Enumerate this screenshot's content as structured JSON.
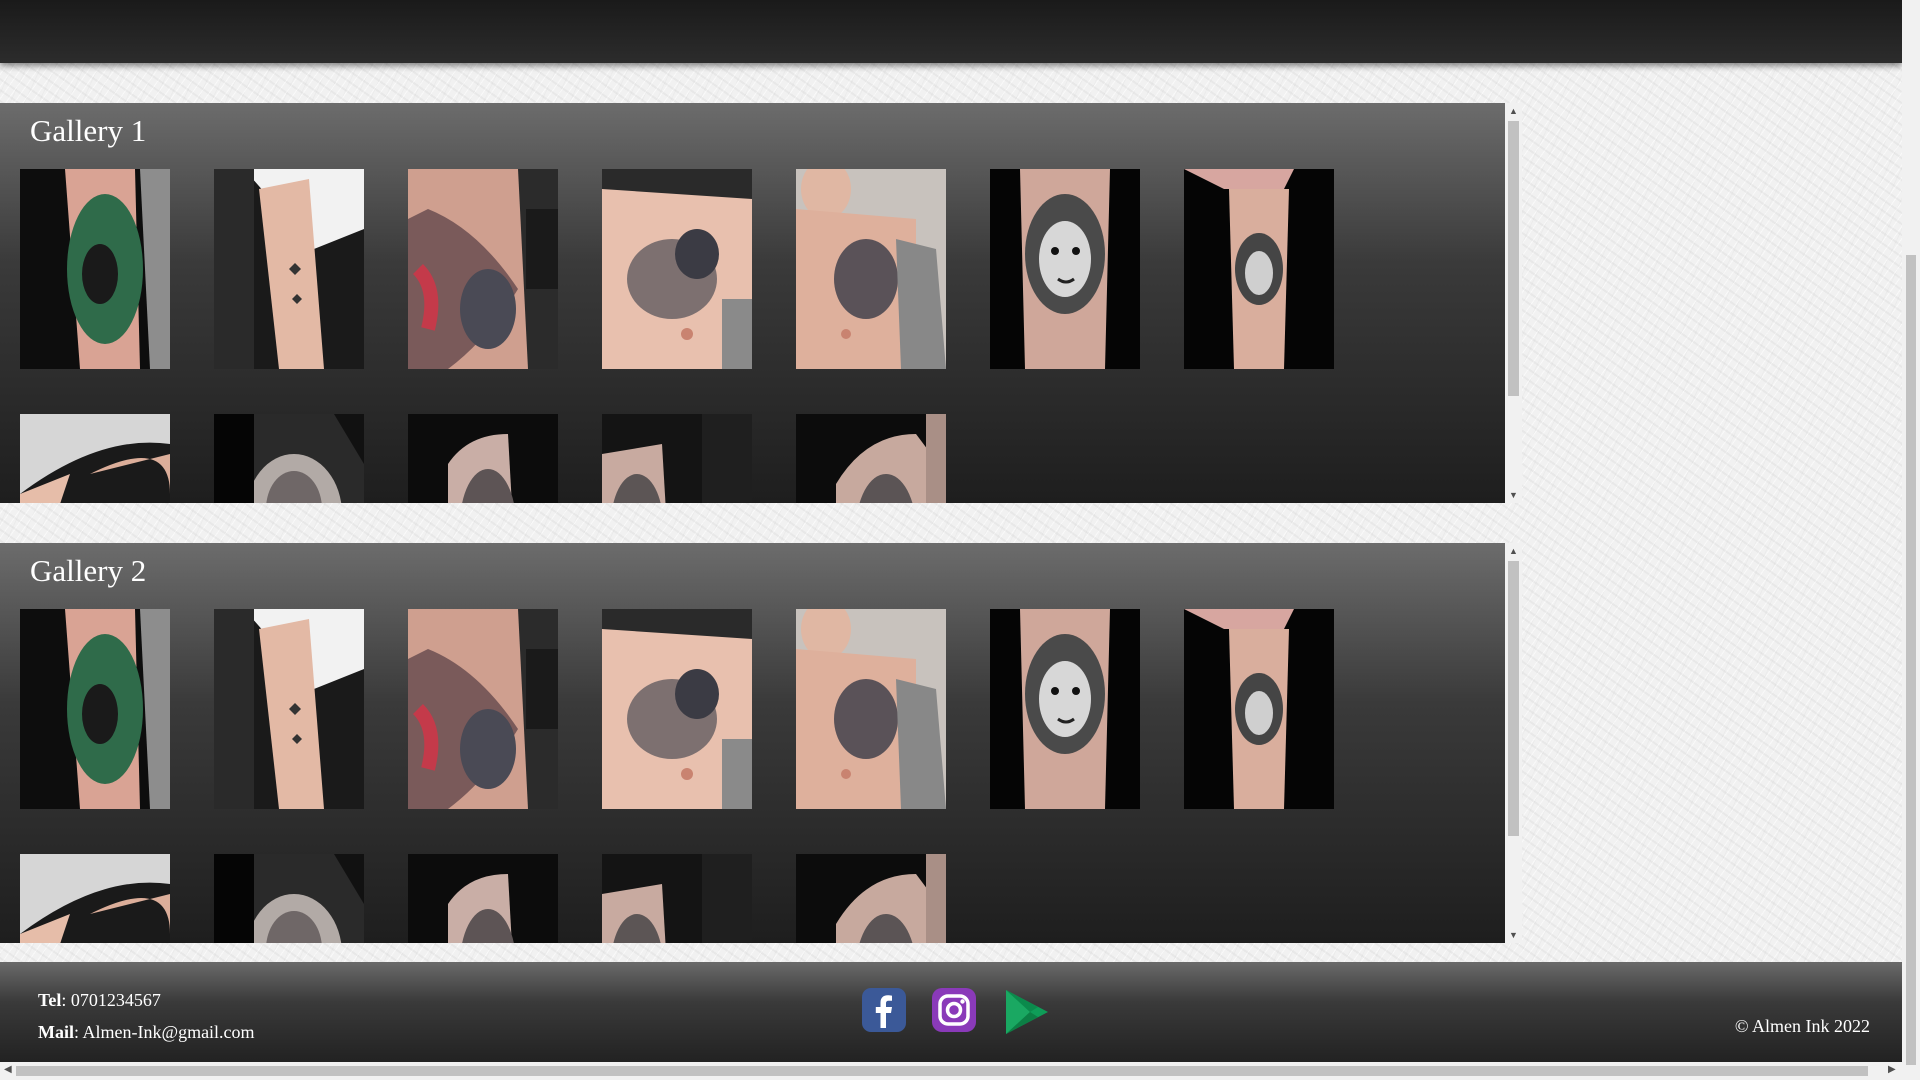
{
  "galleries": [
    {
      "title": "Gallery 1"
    },
    {
      "title": "Gallery 2"
    }
  ],
  "footer": {
    "tel_label": "Tel",
    "tel_value": ": 0701234567",
    "mail_label": "Mail",
    "mail_value": ": Almen-Ink@gmail.com",
    "copyright": "© Almen Ink 2022",
    "social_icons": [
      "facebook-icon",
      "instagram-icon",
      "google-play-icon"
    ]
  },
  "colors": {
    "facebook": "#3b5998",
    "instagram": "#8a3ab9",
    "google_play": "#0f9d58"
  }
}
